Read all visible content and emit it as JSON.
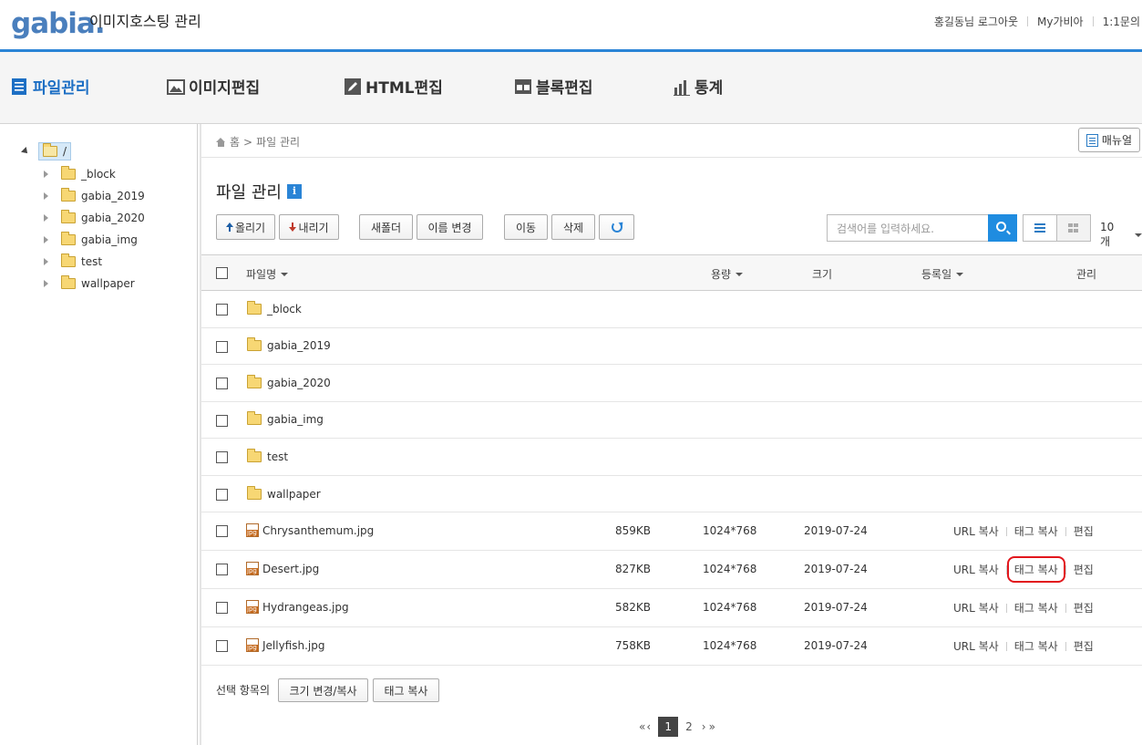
{
  "header": {
    "logo_text": "gabia.",
    "app_title": "이미지호스팅 관리",
    "links": [
      "홍길동님 로그아웃",
      "My가비아",
      "1:1문의"
    ]
  },
  "nav": [
    {
      "label": "파일관리",
      "icon": "file-list-icon",
      "active": true
    },
    {
      "label": "이미지편집",
      "icon": "image-edit-icon",
      "active": false
    },
    {
      "label": "HTML편집",
      "icon": "pencil-icon",
      "active": false
    },
    {
      "label": "블록편집",
      "icon": "block-icon",
      "active": false
    },
    {
      "label": "통계",
      "icon": "bar-chart-icon",
      "active": false
    }
  ],
  "tree": {
    "root": "/",
    "items": [
      "_block",
      "gabia_2019",
      "gabia_2020",
      "gabia_img",
      "test",
      "wallpaper"
    ]
  },
  "breadcrumb": {
    "home": "홈",
    "sep": ">",
    "current": "파일 관리"
  },
  "manual_label": "매뉴얼",
  "page_title": "파일 관리",
  "info_icon_text": "i",
  "toolbar": {
    "upload": "올리기",
    "download": "내리기",
    "new_folder": "새폴더",
    "rename": "이름 변경",
    "move": "이동",
    "delete": "삭제",
    "search_placeholder": "검색어를 입력하세요.",
    "per_page": "10개"
  },
  "table": {
    "headers": {
      "name": "파일명",
      "size": "용량",
      "dimension": "크기",
      "date": "등록일",
      "manage": "관리"
    },
    "folders": [
      "_block",
      "gabia_2019",
      "gabia_2020",
      "gabia_img",
      "test",
      "wallpaper"
    ],
    "files": [
      {
        "name": "Chrysanthemum.jpg",
        "size": "859KB",
        "dimension": "1024*768",
        "date": "2019-07-24"
      },
      {
        "name": "Desert.jpg",
        "size": "827KB",
        "dimension": "1024*768",
        "date": "2019-07-24"
      },
      {
        "name": "Hydrangeas.jpg",
        "size": "582KB",
        "dimension": "1024*768",
        "date": "2019-07-24"
      },
      {
        "name": "Jellyfish.jpg",
        "size": "758KB",
        "dimension": "1024*768",
        "date": "2019-07-24"
      }
    ],
    "actions": {
      "url_copy": "URL 복사",
      "tag_copy": "태그 복사",
      "edit": "편집"
    },
    "highlight_color": "#e2161c"
  },
  "bottom": {
    "selected_label": "선택 항목의",
    "resize_copy": "크기 변경/복사",
    "tag_copy": "태그 복사"
  },
  "pagination": {
    "first": "«",
    "prev": "‹",
    "current": "1",
    "next_page": "2",
    "next": "›",
    "last": "»"
  },
  "colors": {
    "accent": "#1d6fc4",
    "topline": "#2a84d6",
    "search_btn": "#1f8ce0"
  }
}
